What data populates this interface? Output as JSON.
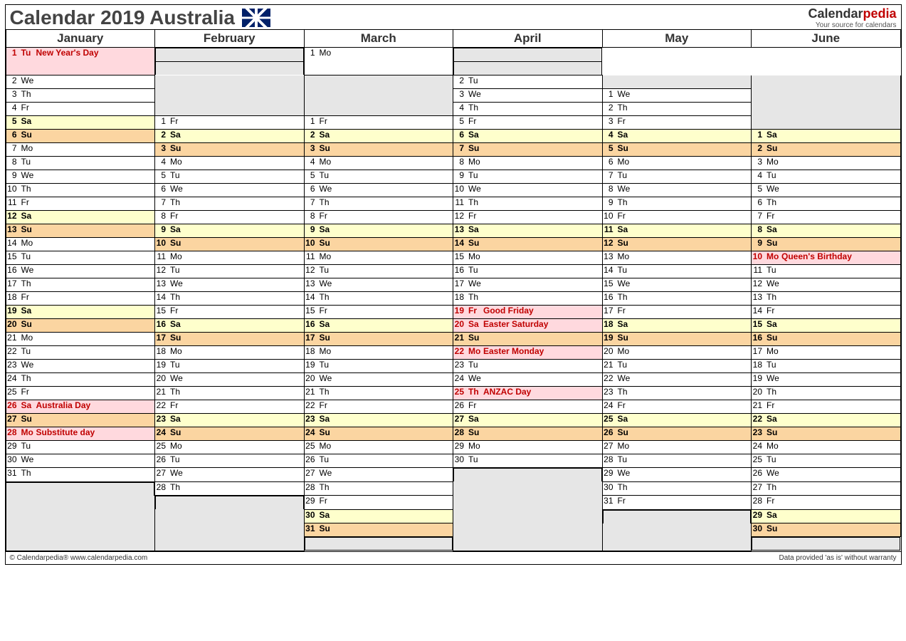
{
  "title": "Calendar 2019 Australia",
  "brand": {
    "name1": "Calendar",
    "name2": "pedia",
    "tag": "Your source for calendars"
  },
  "footer": {
    "left": "© Calendarpedia®   www.calendarpedia.com",
    "right": "Data provided 'as is' without warranty"
  },
  "months": [
    "January",
    "February",
    "March",
    "April",
    "May",
    "June"
  ],
  "rows": 36,
  "data": {
    "January": {
      "start": 1,
      "dow": 2,
      "len": 31,
      "hol": {
        "1": "New Year's Day",
        "26": "Australia Day",
        "28": "Substitute day"
      }
    },
    "February": {
      "start": 5,
      "dow": 5,
      "len": 28,
      "hol": {}
    },
    "March": {
      "start": 5,
      "dow": 5,
      "len": 31,
      "hol": {}
    },
    "April": {
      "start": 1,
      "dow": 1,
      "len": 30,
      "hol": {
        "19": "Good Friday",
        "20": "Easter Saturday",
        "22": "Easter Monday",
        "25": "ANZAC Day"
      }
    },
    "May": {
      "start": 3,
      "dow": 3,
      "len": 31,
      "hol": {}
    },
    "June": {
      "start": 6,
      "dow": 6,
      "len": 30,
      "hol": {
        "10": "Queen's Birthday"
      }
    }
  },
  "dows": [
    "Su",
    "Mo",
    "Tu",
    "We",
    "Th",
    "Fr",
    "Sa"
  ]
}
